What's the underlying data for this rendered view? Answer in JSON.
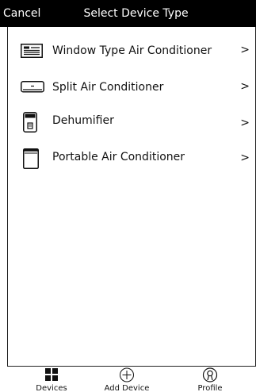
{
  "header": {
    "cancel_label": "Cancel",
    "title": "Select Device Type",
    "background": "#000000",
    "text_color": "#ffffff"
  },
  "devices": [
    {
      "label": "Window Type Air Conditioner",
      "icon": "window-ac-icon",
      "chevron": ">"
    },
    {
      "label": "Split Air Conditioner",
      "icon": "split-ac-icon",
      "chevron": ">"
    },
    {
      "label": "Dehumifier",
      "icon": "dehumidifier-icon",
      "chevron": ">"
    },
    {
      "label": "Portable Air Conditioner",
      "icon": "portable-ac-icon",
      "chevron": ">"
    }
  ],
  "tabbar": {
    "tabs": [
      {
        "label": "Devices",
        "icon": "grid-icon"
      },
      {
        "label": "Add Device",
        "icon": "add-circle-icon"
      },
      {
        "label": "Profile",
        "icon": "profile-icon"
      }
    ]
  }
}
